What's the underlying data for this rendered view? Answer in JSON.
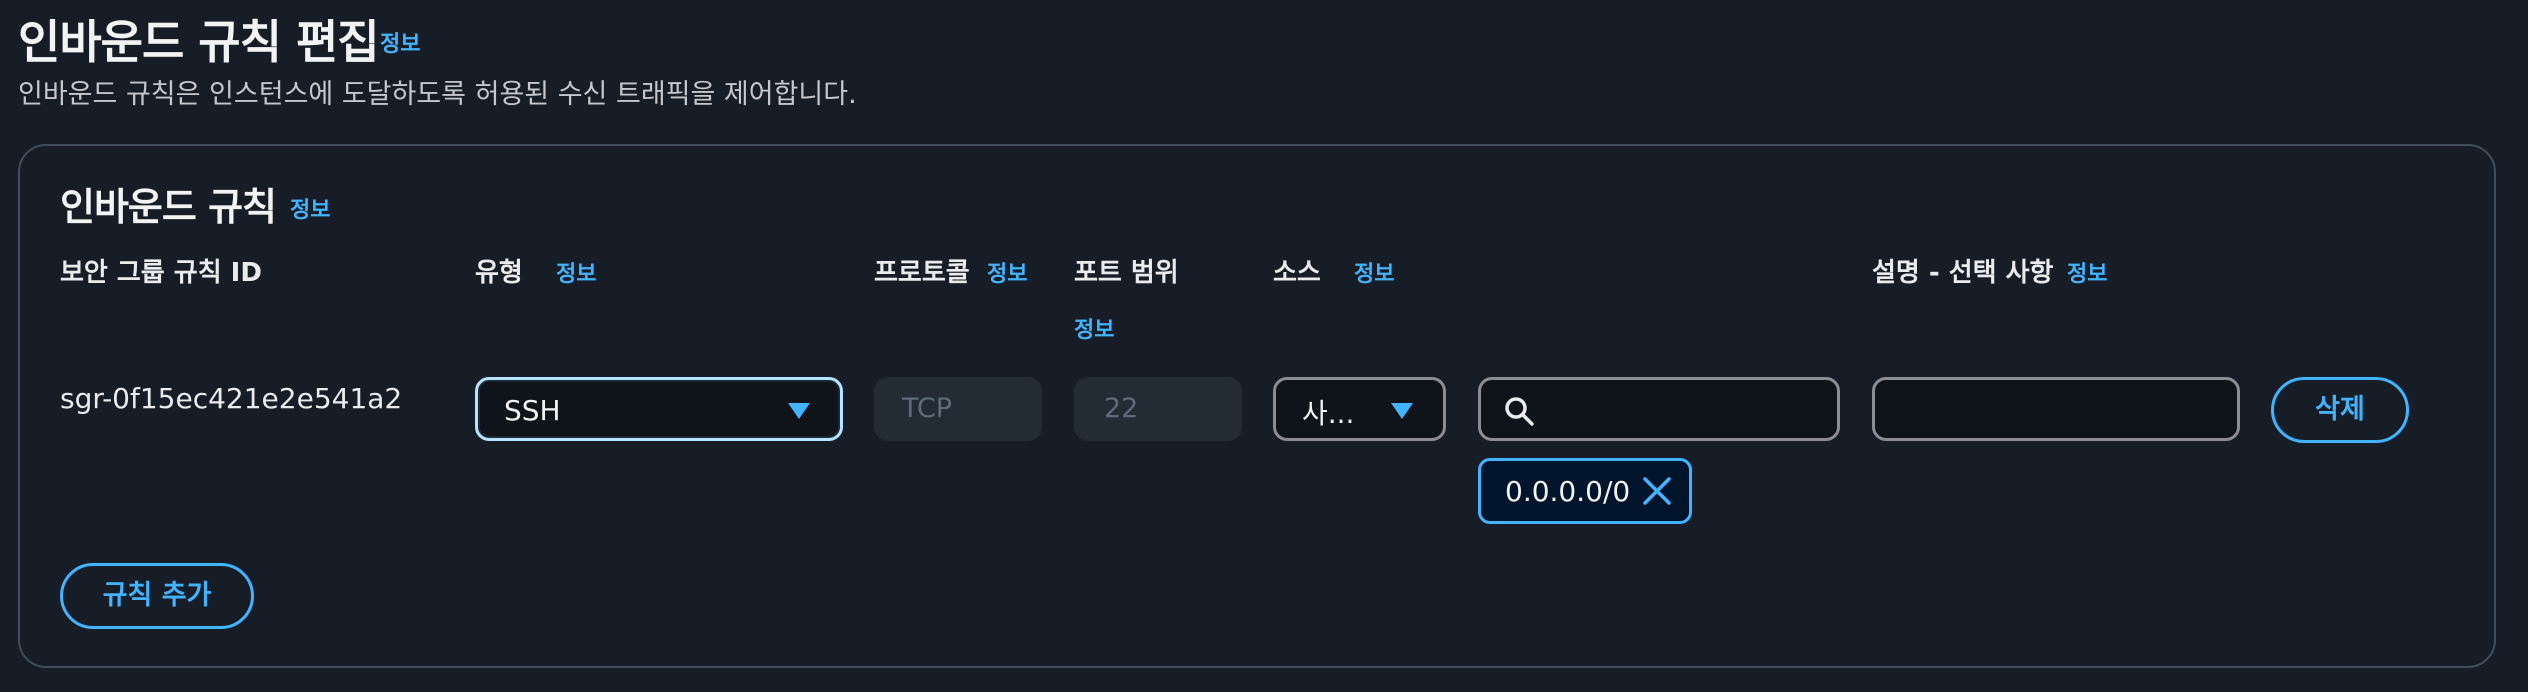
{
  "page": {
    "title": "인바운드 규칙 편집",
    "title_info": "정보",
    "description": "인바운드 규칙은 인스턴스에 도달하도록 허용된 수신 트래픽을 제어합니다."
  },
  "section": {
    "title": "인바운드 규칙",
    "info": "정보"
  },
  "columns": {
    "rule_id": "보안 그룹 규칙 ID",
    "type": "유형",
    "type_info": "정보",
    "protocol": "프로토콜",
    "protocol_info": "정보",
    "port_range": "포트 범위",
    "port_range_info": "정보",
    "source": "소스",
    "source_info": "정보",
    "description": "설명 - 선택 사항",
    "description_info": "정보"
  },
  "rules": [
    {
      "rule_id": "sgr-0f15ec421e2e541a2",
      "type": "SSH",
      "protocol": "TCP",
      "port_range": "22",
      "source_type": "사...",
      "search_value": "",
      "source_token": "0.0.0.0/0",
      "description": "",
      "delete_label": "삭제"
    }
  ],
  "add_rule_label": "규칙 추가",
  "colors": {
    "background": "#161d26",
    "accent": "#42b4ff",
    "border": "#414d5c"
  }
}
